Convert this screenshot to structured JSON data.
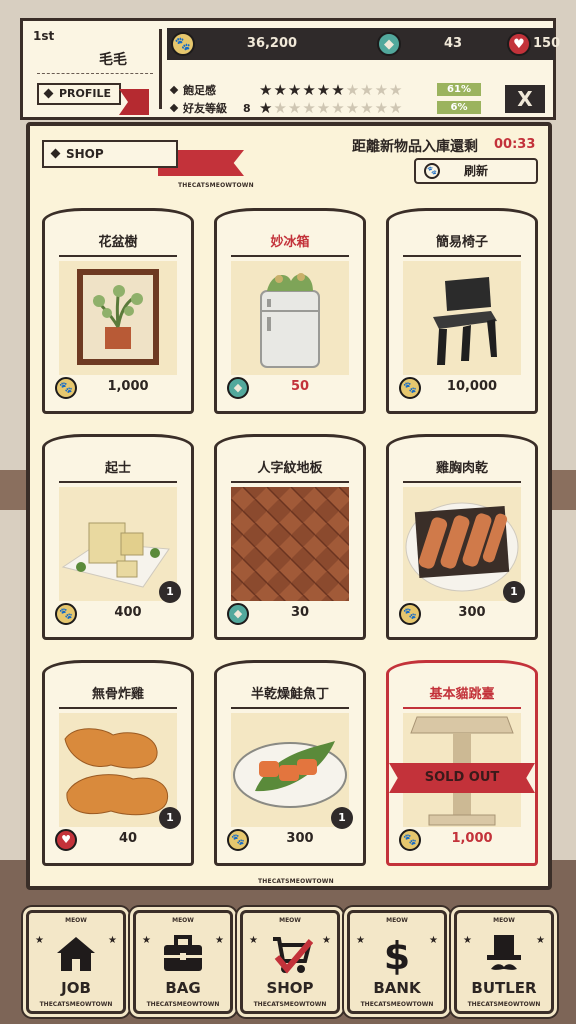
{
  "player": {
    "rank": "1st",
    "name": "毛毛",
    "profile_label": "PROFILE"
  },
  "resources": {
    "coins": "36,200",
    "gems": "43",
    "hearts": "150"
  },
  "stats": [
    {
      "label": "飽足感",
      "level": "",
      "stars_filled": 6,
      "stars_total": 10,
      "percent": "61%"
    },
    {
      "label": "好友等級",
      "level": "8",
      "stars_filled": 1.5,
      "stars_total": 10,
      "percent": "6%"
    }
  ],
  "close_label": "X",
  "shop": {
    "label": "SHOP",
    "brand": "THECATSMEOWTOWN",
    "restock_text": "距離新物品入庫還剩",
    "restock_timer": "00:33",
    "refresh_label": "刷新",
    "items": [
      {
        "name": "花盆樹",
        "price": "1,000",
        "currency": "coin",
        "count": "",
        "sold_out": false,
        "title_red": false,
        "img": "plant"
      },
      {
        "name": "妙冰箱",
        "price": "50",
        "currency": "gem",
        "count": "",
        "sold_out": false,
        "title_red": true,
        "img": "fridge"
      },
      {
        "name": "簡易椅子",
        "price": "10,000",
        "currency": "coin",
        "count": "",
        "sold_out": false,
        "title_red": false,
        "img": "chair"
      },
      {
        "name": "起士",
        "price": "400",
        "currency": "coin",
        "count": "1",
        "sold_out": false,
        "title_red": false,
        "img": "cheese"
      },
      {
        "name": "人字紋地板",
        "price": "30",
        "currency": "gem",
        "count": "",
        "sold_out": false,
        "title_red": false,
        "img": "floor"
      },
      {
        "name": "雞胸肉乾",
        "price": "300",
        "currency": "coin",
        "count": "1",
        "sold_out": false,
        "title_red": false,
        "img": "jerky"
      },
      {
        "name": "無骨炸雞",
        "price": "40",
        "currency": "heart",
        "count": "1",
        "sold_out": false,
        "title_red": false,
        "img": "chicken"
      },
      {
        "name": "半乾燥鮭魚丁",
        "price": "300",
        "currency": "coin",
        "count": "1",
        "sold_out": false,
        "title_red": false,
        "img": "salmon"
      },
      {
        "name": "基本貓跳臺",
        "price": "1,000",
        "currency": "coin",
        "count": "",
        "sold_out": true,
        "title_red": true,
        "img": "tower"
      }
    ],
    "sold_out_label": "SOLD OUT"
  },
  "nav": {
    "meow": "MEOW",
    "brand": "THECATSMEOWTOWN",
    "items": [
      {
        "label": "JOB",
        "icon": "house-icon"
      },
      {
        "label": "BAG",
        "icon": "bag-icon"
      },
      {
        "label": "SHOP",
        "icon": "cart-icon"
      },
      {
        "label": "BANK",
        "icon": "dollar-icon"
      },
      {
        "label": "BUTLER",
        "icon": "top-hat-icon"
      }
    ]
  },
  "colors": {
    "accent_red": "#c3323a",
    "dark": "#2f2a2a",
    "paper": "#fbf3d9",
    "percent_green": "#9bb35e"
  }
}
